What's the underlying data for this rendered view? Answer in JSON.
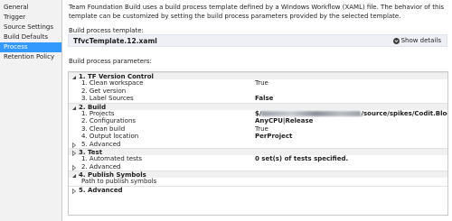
{
  "sidebar": {
    "items": [
      {
        "label": "General",
        "selected": false
      },
      {
        "label": "Trigger",
        "selected": false
      },
      {
        "label": "Source Settings",
        "selected": false
      },
      {
        "label": "Build Defaults",
        "selected": false
      },
      {
        "label": "Process",
        "selected": true
      },
      {
        "label": "Retention Policy",
        "selected": false
      }
    ]
  },
  "main": {
    "description": "Team Foundation Build uses a build process template defined by a Windows Workflow (XAML) file. The behavior of this template can be customized by setting the build process parameters provided by the selected template.",
    "template_label": "Build process template:",
    "template_name": "TfvcTemplate.12.xaml",
    "show_details": "Show details",
    "params_label": "Build process parameters:"
  },
  "grid": {
    "cat1": "1. TF Version Control",
    "cat1_rows": [
      {
        "name": "1. Clean workspace",
        "value": "True"
      },
      {
        "name": "2. Get version",
        "value": ""
      },
      {
        "name": "3. Label Sources",
        "value": "False"
      }
    ],
    "cat2": "2. Build",
    "cat2_rows": [
      {
        "name": "1. Projects",
        "value_prefix": "$/",
        "value_suffix": "/source/spikes/Codit.Blog.lsVsoBuild..."
      },
      {
        "name": "2. Configurations",
        "value": "AnyCPU|Release"
      },
      {
        "name": "3. Clean build",
        "value": "True"
      },
      {
        "name": "4. Output location",
        "value": "PerProject"
      }
    ],
    "cat2_advanced": "5. Advanced",
    "cat3": "3. Test",
    "cat3_rows": [
      {
        "name": "1. Automated tests",
        "value": "0 set(s) of tests specified."
      }
    ],
    "cat3_advanced": "2. Advanced",
    "cat4": "4. Publish Symbols",
    "cat4_rows": [
      {
        "name": "Path to publish symbols",
        "value": ""
      }
    ],
    "cat5": "5. Advanced"
  },
  "colors": {
    "selected": "#3399ff",
    "sidebar_bg": "#f2f2f2",
    "category_bg": "#f0f0f0"
  }
}
